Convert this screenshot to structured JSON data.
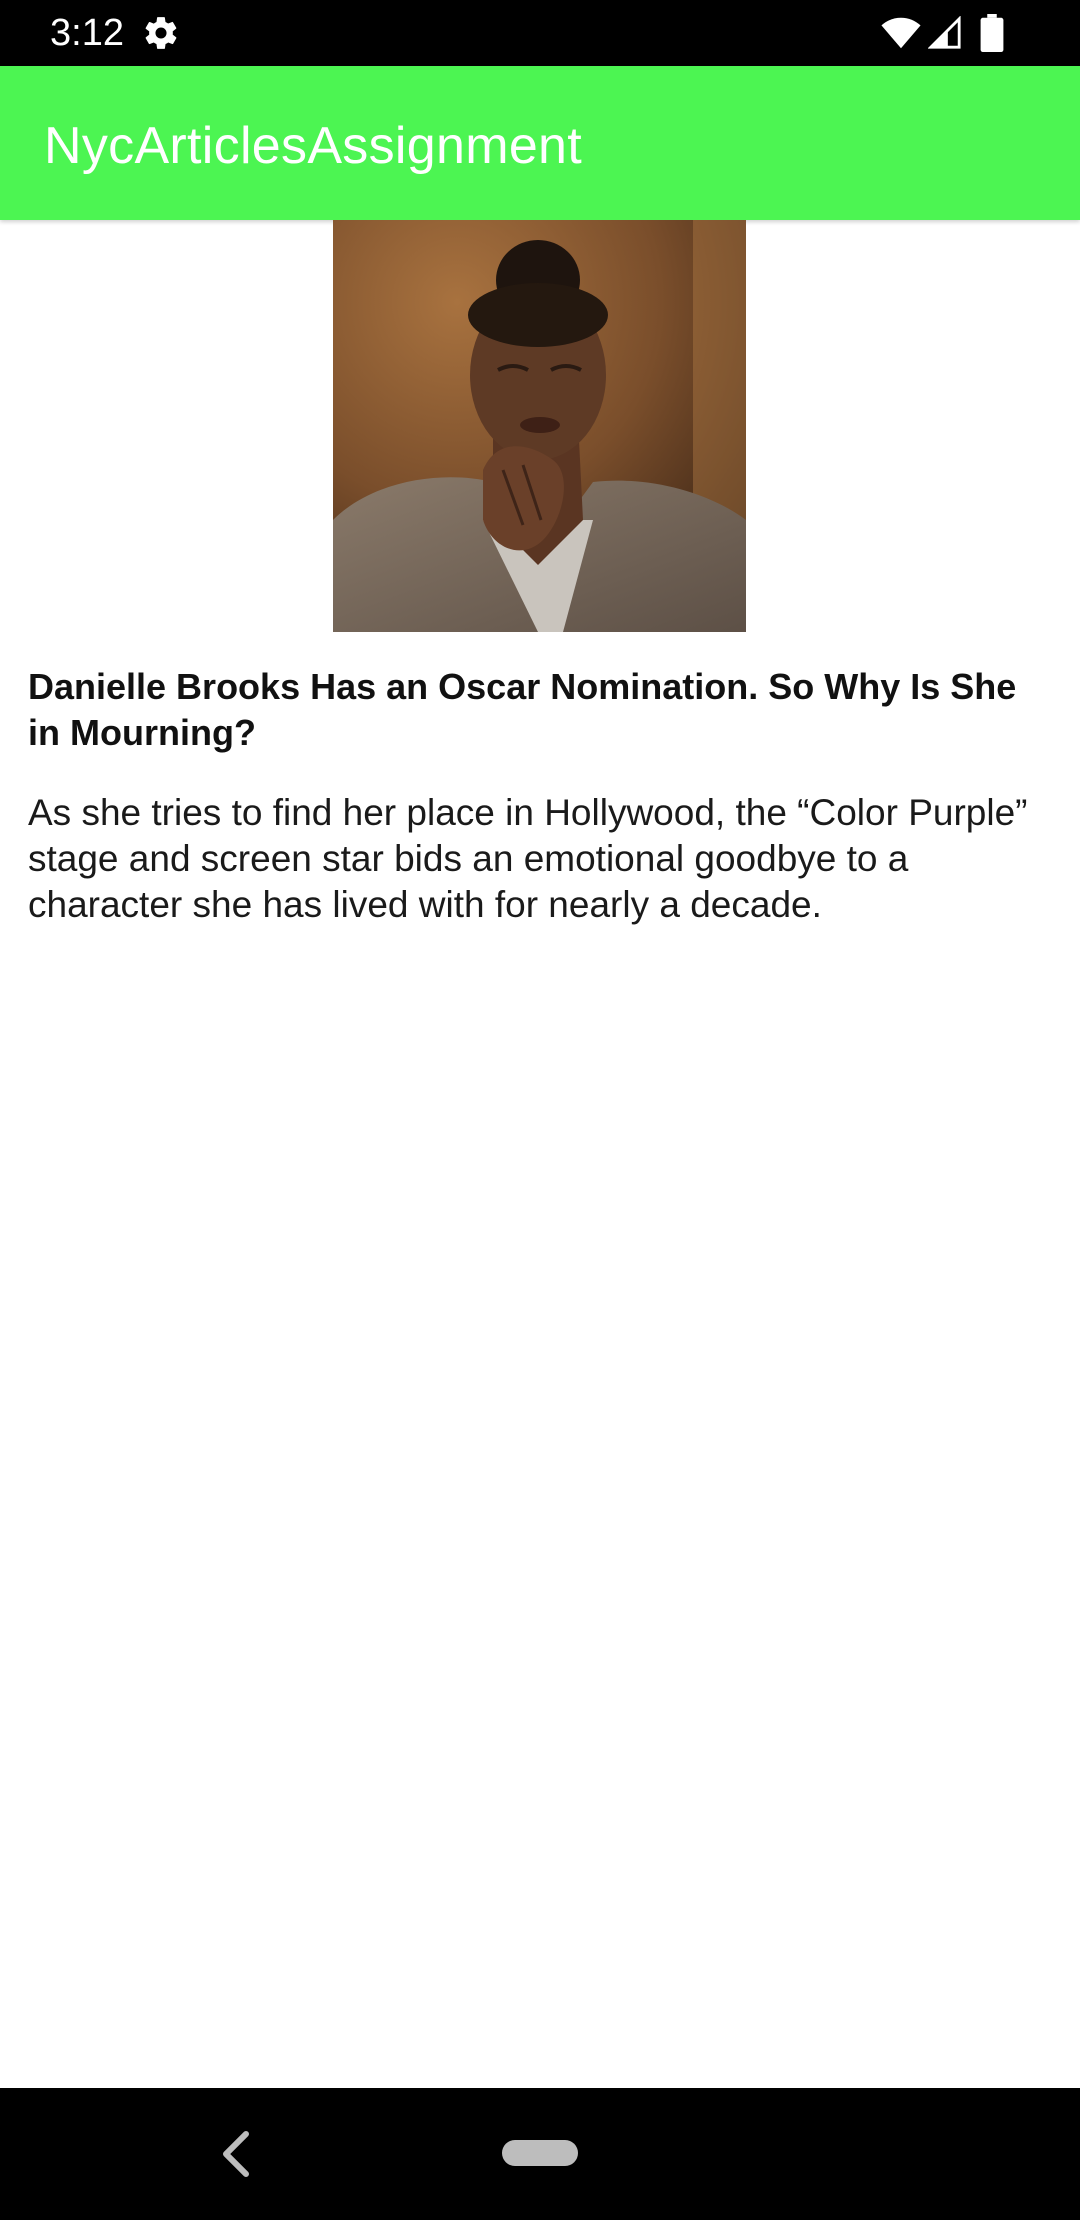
{
  "status_bar": {
    "time": "3:12",
    "icons": [
      "settings-icon",
      "wifi-icon",
      "signal-icon",
      "battery-icon"
    ]
  },
  "app_bar": {
    "title": "NycArticlesAssignment",
    "color": "#4cf552"
  },
  "article": {
    "image_icon": "portrait-photo",
    "headline": "Danielle Brooks Has an Oscar Nomination. So Why Is She in Mourning?",
    "abstract": "As she tries to find her place in Hollywood, the “Color Purple” stage and screen star bids an emotional goodbye to a character she has lived with for nearly a decade."
  },
  "nav_bar": {
    "icons": [
      "back-icon",
      "home-pill-icon"
    ]
  }
}
